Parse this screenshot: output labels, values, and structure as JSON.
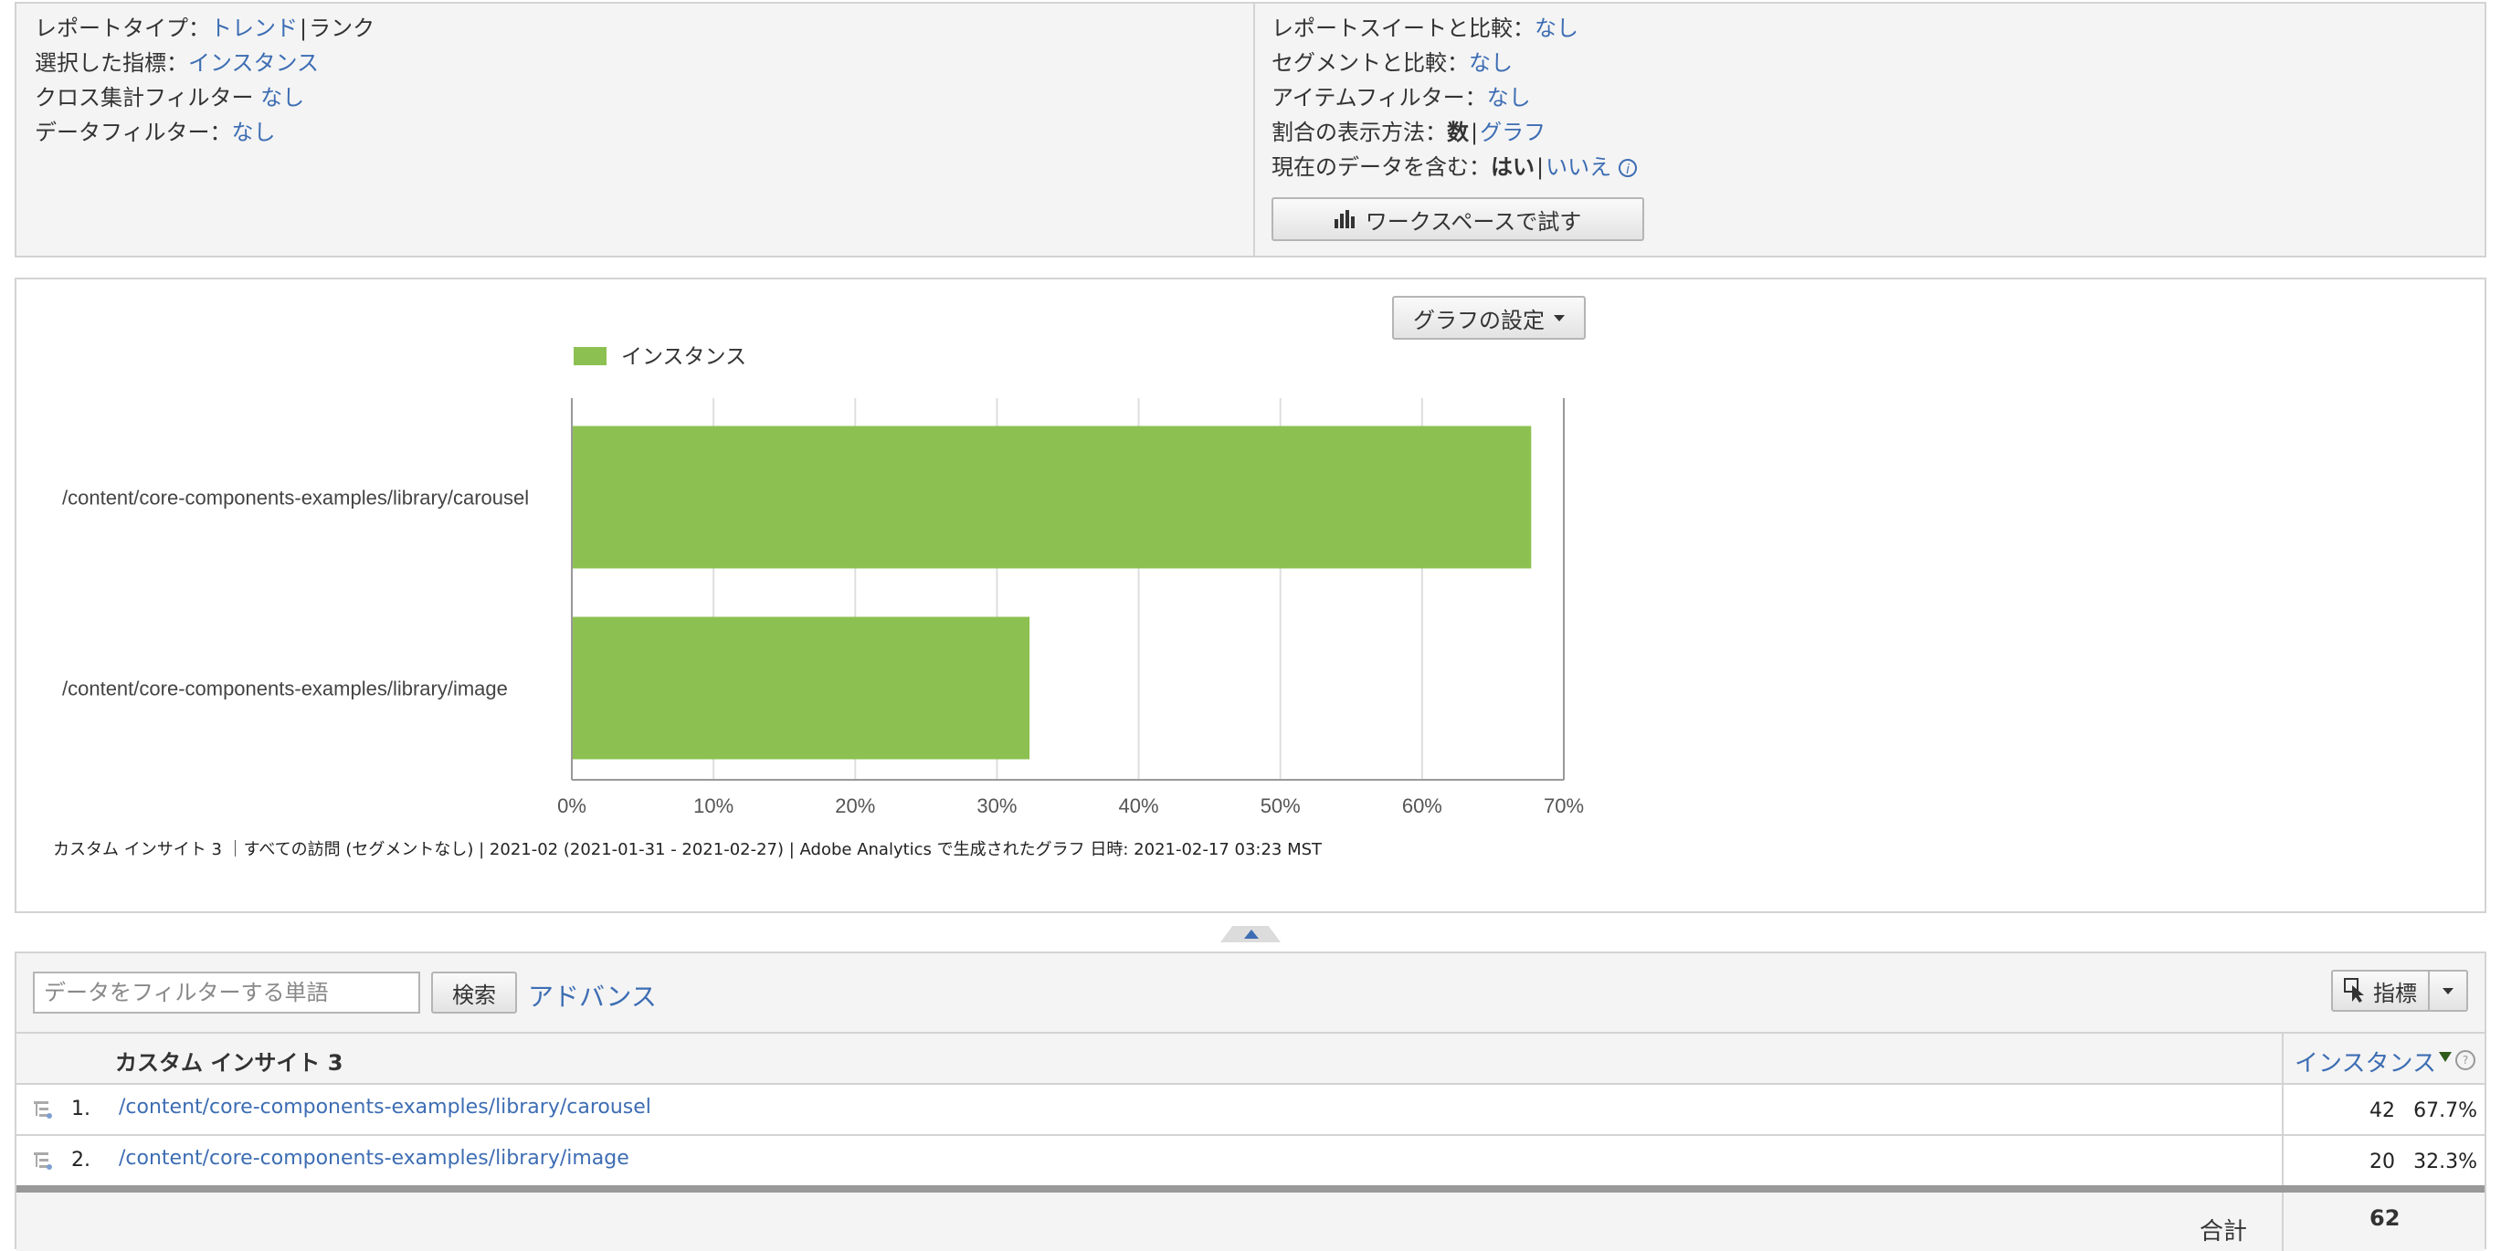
{
  "settings": {
    "report_type_label": "レポートタイプ：",
    "report_type_trend": "トレンド",
    "report_type_rank": "ランク",
    "selected_metric_label": "選択した指標：",
    "selected_metric_value": "インスタンス",
    "cross_filter_label": "クロス集計フィルター",
    "cross_filter_value": "なし",
    "data_filter_label": "データフィルター：",
    "data_filter_value": "なし",
    "compare_suite_label": "レポートスイートと比較：",
    "compare_suite_value": "なし",
    "compare_segment_label": "セグメントと比較：",
    "compare_segment_value": "なし",
    "item_filter_label": "アイテムフィルター：",
    "item_filter_value": "なし",
    "percent_display_label": "割合の表示方法：",
    "percent_display_number": "数",
    "percent_display_graph": "グラフ",
    "include_current_label": "現在のデータを含む：",
    "include_current_yes": "はい",
    "include_current_no": "いいえ",
    "info_symbol": "i",
    "try_workspace_label": "ワークスペースで試す"
  },
  "chart": {
    "settings_button_label": "グラフの設定",
    "footer": "カスタム インサイト 3 ｜すべての訪問 (セグメントなし) | 2021-02 (2021-01-31 - 2021-02-27) | Adobe Analytics で生成されたグラフ 日時: 2021-02-17 03:23 MST"
  },
  "chart_data": {
    "type": "bar",
    "orientation": "horizontal",
    "categories": [
      "/content/core-components-examples/library/carousel",
      "/content/core-components-examples/library/image"
    ],
    "series": [
      {
        "name": "インスタンス",
        "values": [
          67.7,
          32.3
        ],
        "color": "#8cc152"
      }
    ],
    "xlim": [
      0,
      70
    ],
    "xticks": [
      "0%",
      "10%",
      "20%",
      "30%",
      "40%",
      "50%",
      "60%",
      "70%"
    ],
    "grid": true,
    "legend": "top-left"
  },
  "table": {
    "filter_placeholder": "データをフィルターする単語",
    "search_label": "検索",
    "advanced_label": "アドバンス",
    "metrics_button_label": "指標",
    "dimension_header": "カスタム インサイト 3",
    "metric_header": "インスタンス",
    "help_symbol": "?",
    "rows": [
      {
        "num": "1.",
        "item": "/content/core-components-examples/library/carousel",
        "value": "42",
        "pct": "67.7%"
      },
      {
        "num": "2.",
        "item": "/content/core-components-examples/library/image",
        "value": "20",
        "pct": "32.3%"
      }
    ],
    "total_label": "合計",
    "total_value": "62"
  },
  "colors": {
    "link": "#3d6db3",
    "bar": "#8cc152",
    "panel_bg": "#f4f4f4",
    "border": "#d3d3d3"
  }
}
